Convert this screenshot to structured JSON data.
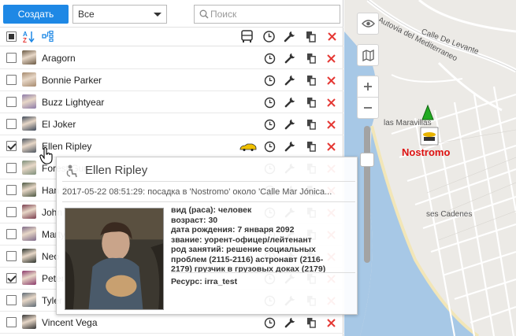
{
  "toolbar": {
    "create_label": "Создать",
    "filter_value": "Все",
    "search_placeholder": "Поиск"
  },
  "users": [
    {
      "name": "Aragorn",
      "checked": false,
      "avatar_color": "#6b5a44"
    },
    {
      "name": "Bonnie Parker",
      "checked": false,
      "avatar_color": "#a68a6e"
    },
    {
      "name": "Buzz Lightyear",
      "checked": false,
      "avatar_color": "#8c7aa8"
    },
    {
      "name": "El Joker",
      "checked": false,
      "avatar_color": "#3f4a5a"
    },
    {
      "name": "Ellen Ripley",
      "checked": true,
      "avatar_color": "#4e5660"
    },
    {
      "name": "Forest Gump",
      "checked": false,
      "avatar_color": "#7e8f7a"
    },
    {
      "name": "Han Solo",
      "checked": false,
      "avatar_color": "#4c5842"
    },
    {
      "name": "John McClane",
      "checked": false,
      "avatar_color": "#7a3d4e"
    },
    {
      "name": "Marty McFly",
      "checked": false,
      "avatar_color": "#7e6a88"
    },
    {
      "name": "Neo",
      "checked": false,
      "avatar_color": "#2d332d"
    },
    {
      "name": "Peter Parker",
      "checked": true,
      "avatar_color": "#8b3a6b"
    },
    {
      "name": "Tyler Durden",
      "checked": false,
      "avatar_color": "#5e6a74"
    },
    {
      "name": "Vincent Vega",
      "checked": false,
      "avatar_color": "#333333"
    }
  ],
  "map": {
    "unit_name": "Nostromo",
    "labels": {
      "street": "Autovia del Mediterraneo",
      "street2": "Calle De Levante",
      "area1": "las Maravillas",
      "area2": "ses Cadenes"
    }
  },
  "popup": {
    "title": "Ellen Ripley",
    "event": "2017-05-22 08:51:29: посадка в 'Nostromo' около 'Calle Mar Jónica...",
    "info": [
      "вид (раса): человек",
      "возраст: 30",
      "дата рождения: 7 января 2092",
      "звание: уорент-офицер/лейтенант",
      "род занятий: решение социальных проблем (2115-2116) астронавт (2116-2179) грузчик в грузовых доках (2179)"
    ],
    "resource": "Ресурс: irra_test"
  },
  "colors": {
    "accent": "#1e88e5",
    "delete": "#e53935",
    "unit_label": "#dd1111"
  }
}
